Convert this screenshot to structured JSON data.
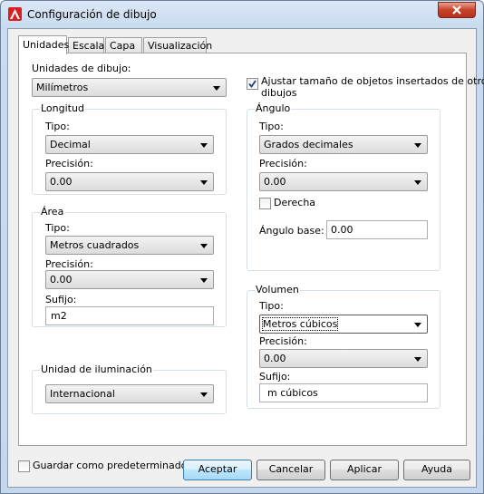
{
  "window": {
    "title": "Configuración de dibujo"
  },
  "tabs": [
    "Unidades",
    "Escala",
    "Capa",
    "Visualización"
  ],
  "units": {
    "drawing_units_label": "Unidades de dibujo:",
    "drawing_units_value": "Milímetros",
    "scale_inserted_label_line1": "Ajustar tamaño de objetos insertados de otros",
    "scale_inserted_label_line2": "dibujos",
    "scale_inserted_checked": true
  },
  "length": {
    "title": "Longitud",
    "type_label": "Tipo:",
    "type_value": "Decimal",
    "precision_label": "Precisión:",
    "precision_value": "0.00"
  },
  "angle": {
    "title": "Ángulo",
    "type_label": "Tipo:",
    "type_value": "Grados decimales",
    "precision_label": "Precisión:",
    "precision_value": "0.00",
    "clockwise_label": "Derecha",
    "clockwise_checked": false,
    "base_label": "Ángulo base:",
    "base_value": "0.00"
  },
  "area": {
    "title": "Área",
    "type_label": "Tipo:",
    "type_value": "Metros cuadrados",
    "precision_label": "Precisión:",
    "precision_value": "0.00",
    "suffix_label": "Sufijo:",
    "suffix_value": "m2"
  },
  "volume": {
    "title": "Volumen",
    "type_label": "Tipo:",
    "type_value": "Metros cúbicos",
    "precision_label": "Precisión:",
    "precision_value": "0.00",
    "suffix_label": "Sufijo:",
    "suffix_value": "m cúbicos"
  },
  "lighting": {
    "title": "Unidad de iluminación",
    "value": "Internacional"
  },
  "footer": {
    "save_default_label": "Guardar como predeterminado",
    "save_default_checked": false,
    "ok": "Aceptar",
    "cancel": "Cancelar",
    "apply": "Aplicar",
    "help": "Ayuda"
  },
  "colors": {
    "app_icon": "#d92020",
    "close_button": "#c8412b",
    "default_button_border": "#3c7fb1"
  }
}
